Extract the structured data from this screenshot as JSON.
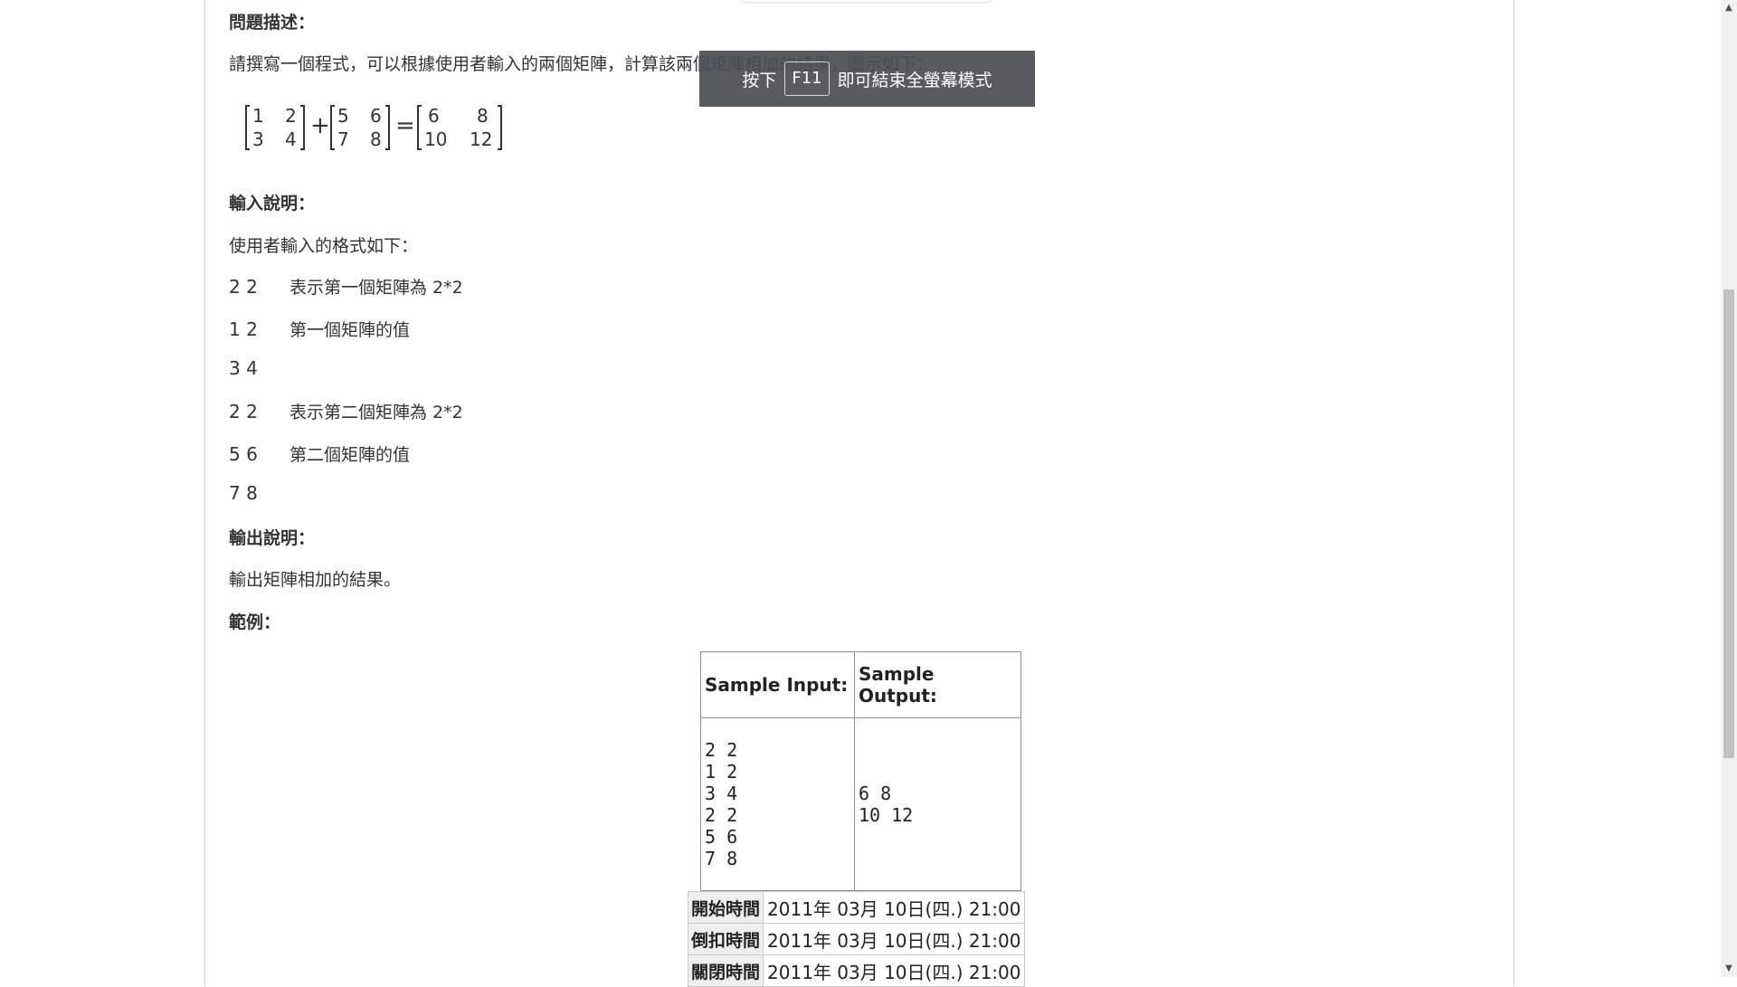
{
  "problem": {
    "description_heading": "問題描述：",
    "description_text": "請撰寫一個程式，可以根據使用者輸入的兩個矩陣，計算該兩個矩陣相加的結果，圖示如下：",
    "matrix_a": [
      "1",
      "2",
      "3",
      "4"
    ],
    "matrix_b": [
      "5",
      "6",
      "7",
      "8"
    ],
    "matrix_c": [
      "6",
      "8",
      "10",
      "12"
    ],
    "plus": "+",
    "equals": "=",
    "input_heading": "輸入說明：",
    "input_intro": "使用者輸入的格式如下：",
    "input_rows": [
      {
        "nums": "2 2",
        "note": "表示第一個矩陣為 2*2"
      },
      {
        "nums": "1 2",
        "note": "第一個矩陣的值"
      },
      {
        "nums": "3 4",
        "note": ""
      },
      {
        "nums": "2 2",
        "note": "表示第二個矩陣為 2*2"
      },
      {
        "nums": "5 6",
        "note": "第二個矩陣的值"
      },
      {
        "nums": "7 8",
        "note": ""
      }
    ],
    "output_heading": "輸出說明：",
    "output_text": "輸出矩陣相加的結果。",
    "example_heading": "範例："
  },
  "sample": {
    "input_header": "Sample Input:",
    "output_header": "Sample Output:",
    "input_lines": [
      "2 2",
      "1 2",
      "3 4",
      "2 2",
      "5 6",
      "7 8"
    ],
    "output_lines": [
      "6 8",
      "10 12"
    ]
  },
  "times": [
    {
      "label": "開始時間",
      "value": "2011年 03月 10日(四.) 21:00"
    },
    {
      "label": "倒扣時間",
      "value": "2011年 03月 10日(四.) 21:00"
    },
    {
      "label": "關閉時間",
      "value": "2011年 03月 10日(四.) 21:00"
    }
  ],
  "fullscreen_notice": {
    "prefix": "按下",
    "key": "F11",
    "suffix": "即可結束全螢幕模式"
  },
  "scrollbar": {
    "up_icon": "triangle-up",
    "down_icon": "triangle-down"
  }
}
